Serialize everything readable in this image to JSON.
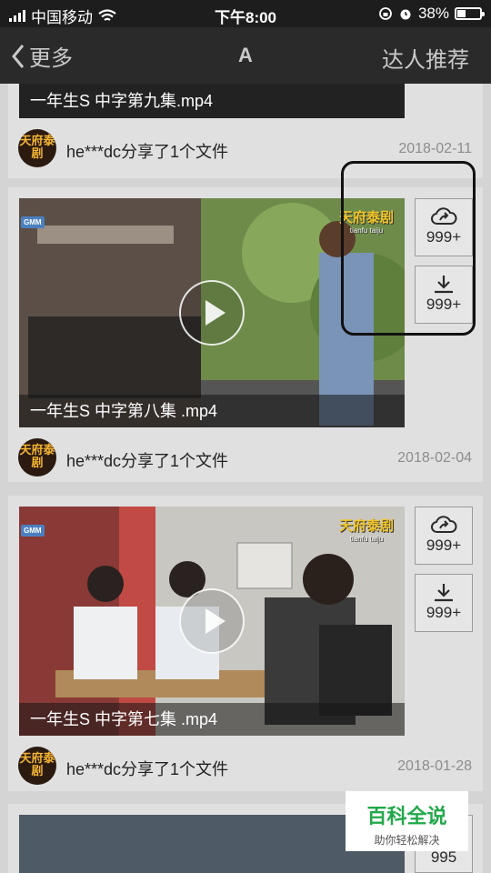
{
  "status_bar": {
    "carrier": "中国移动",
    "time": "下午8:00",
    "battery": "38%",
    "battery_level": 0.38
  },
  "nav": {
    "back_label": "更多",
    "title": "A",
    "right_label": "达人推荐"
  },
  "cards": [
    {
      "caption": "一年生S 中字第九集.mp4",
      "user": "he***dc分享了1个文件",
      "date": "2018-02-11",
      "avatar_text": "天府泰剧"
    },
    {
      "caption": "一年生S 中字第八集 .mp4",
      "user": "he***dc分享了1个文件",
      "date": "2018-02-04",
      "avatar_text": "天府泰剧",
      "share_count": "999+",
      "download_count": "999+",
      "logo": "天府泰剧",
      "logo_sub": "tianfu taiju",
      "gmm": "GMM"
    },
    {
      "caption": "一年生S 中字第七集 .mp4",
      "user": "he***dc分享了1个文件",
      "date": "2018-01-28",
      "avatar_text": "天府泰剧",
      "share_count": "999+",
      "download_count": "999+",
      "logo": "天府泰剧",
      "logo_sub": "tianfu taiju",
      "gmm": "GMM"
    },
    {
      "share_count": "995"
    }
  ],
  "watermark": {
    "title": "百科全说",
    "subtitle": "助你轻松解决"
  },
  "colors": {
    "status_bg": "#1d1d1d",
    "nav_bg": "#2a2a2a",
    "card_bg": "#e0e0e0",
    "page_bg": "#d4d4d4",
    "watermark_green": "#22a84a"
  }
}
